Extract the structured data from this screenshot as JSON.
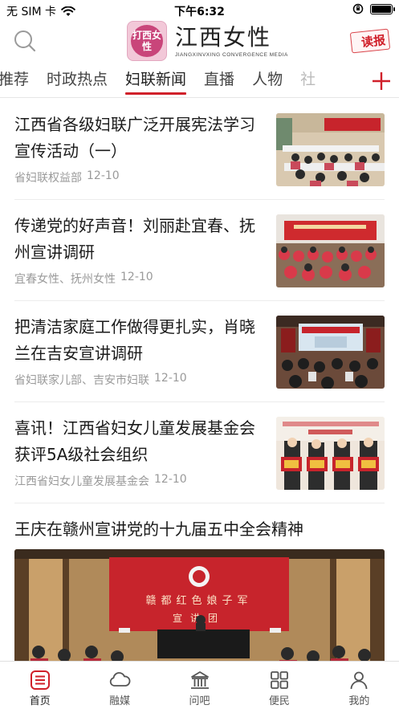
{
  "status_bar": {
    "carrier": "无 SIM 卡",
    "time": "下午6:32"
  },
  "header": {
    "logo_mark_text": "打西女性",
    "app_title": "江西女性",
    "app_subtitle": "JIANGXINVXING CONVERGENCE MEDIA",
    "reader_label": "读报",
    "search_icon": "search-icon"
  },
  "tabs": {
    "items": [
      {
        "label": "推荐"
      },
      {
        "label": "时政热点"
      },
      {
        "label": "妇联新闻"
      },
      {
        "label": "直播"
      },
      {
        "label": "人物"
      },
      {
        "label": "社"
      }
    ],
    "active": "妇联新闻",
    "add_icon": "plus-icon"
  },
  "feed": {
    "items": [
      {
        "title": "江西省各级妇联广泛开展宪法学习宣传活动（一）",
        "source": "省妇联权益部",
        "date": "12-10"
      },
      {
        "title": "传递党的好声音！刘丽赴宜春、抚州宣讲调研",
        "source": "宜春女性、抚州女性",
        "date": "12-10"
      },
      {
        "title": "把清洁家庭工作做得更扎实，肖晓兰在吉安宣讲调研",
        "source": "省妇联家儿部、吉安市妇联",
        "date": "12-10"
      },
      {
        "title": "喜讯！江西省妇女儿童发展基金会获评5A级社会组织",
        "source": "江西省妇女儿童发展基金会",
        "date": "12-10"
      }
    ],
    "featured": {
      "title": "王庆在赣州宣讲党的十九届五中全会精神",
      "banner_line1": "赣都红色娘子军",
      "banner_line2": "宣讲团"
    }
  },
  "bottom_nav": {
    "items": [
      {
        "label": "首页",
        "icon": "home-icon"
      },
      {
        "label": "融媒",
        "icon": "cloud-icon"
      },
      {
        "label": "问吧",
        "icon": "building-icon"
      },
      {
        "label": "便民",
        "icon": "grid-icon"
      },
      {
        "label": "我的",
        "icon": "person-icon"
      }
    ],
    "active": "首页"
  },
  "colors": {
    "accent": "#d0202a",
    "text": "#1a1a1a",
    "meta": "#9a9a9a"
  }
}
